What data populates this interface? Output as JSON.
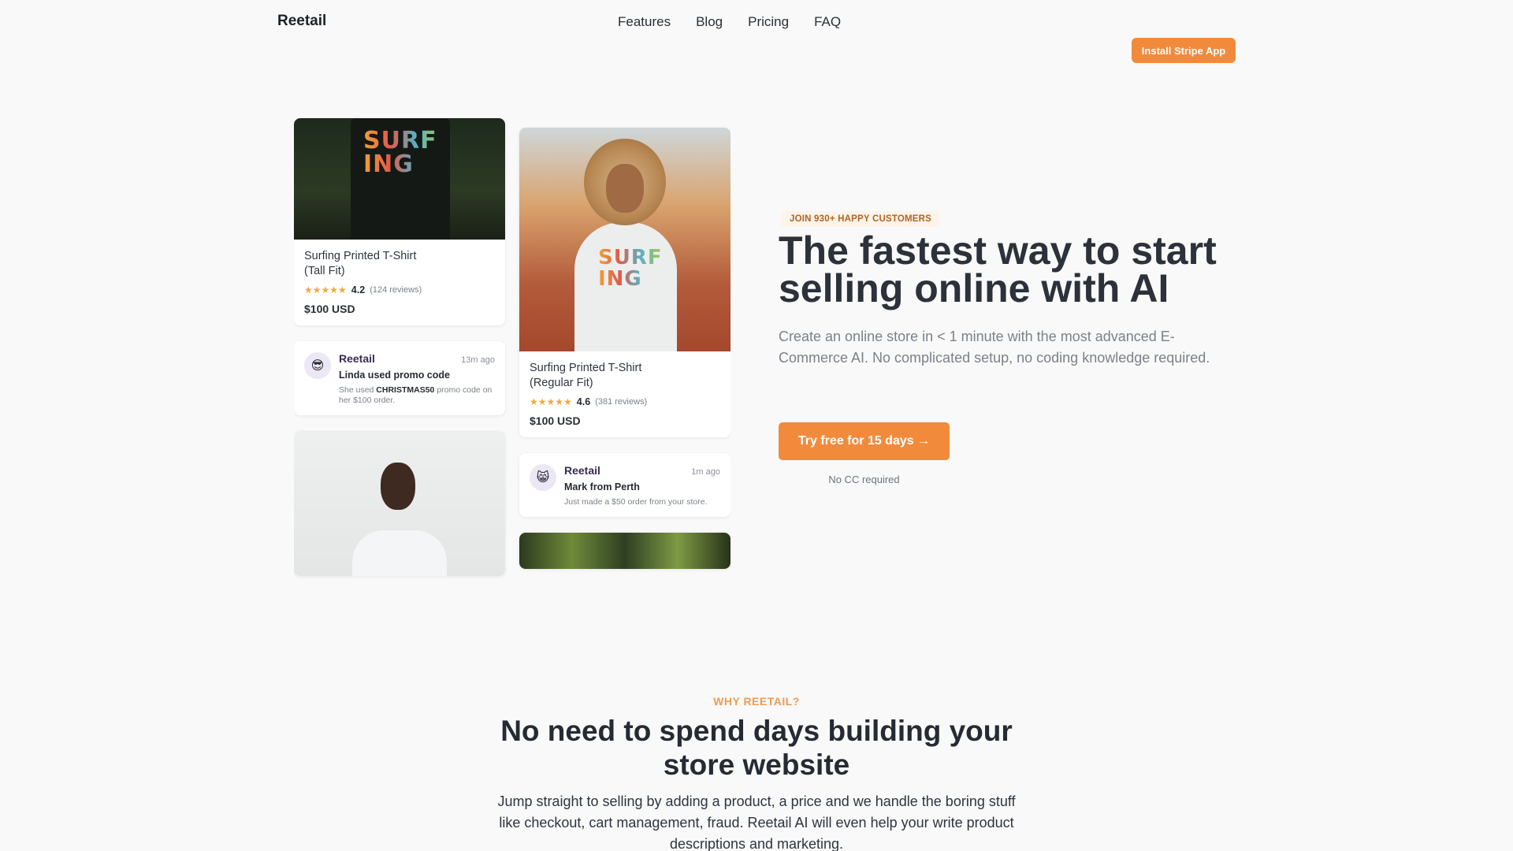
{
  "header": {
    "brand": "Reetail",
    "nav": [
      "Features",
      "Blog",
      "Pricing",
      "FAQ"
    ],
    "install_button": "Install Stripe App"
  },
  "mosaic": {
    "product1": {
      "title_line1": "Surfing Printed T-Shirt",
      "title_line2": "(Tall Fit)",
      "rating": "4.2",
      "reviews": "(124 reviews)",
      "price": "$100 USD",
      "shirt_print": "SURF ING"
    },
    "notif1": {
      "avatar_emoji": "😎",
      "brand": "Reetail",
      "time": "13m ago",
      "title": "Linda used promo code",
      "text_before": "She used",
      "code": "CHRISTMAS50",
      "text_after": "promo code on her $100 order."
    },
    "product2": {
      "title_line1": "Surfing Printed T-Shirt",
      "title_line2": "(Regular Fit)",
      "rating": "4.6",
      "reviews": "(381 reviews)",
      "price": "$100 USD",
      "shirt_print": "SURF ING"
    },
    "notif2": {
      "avatar_emoji": "😸",
      "brand": "Reetail",
      "time": "1m ago",
      "title": "Mark from Perth",
      "text": "Just made a $50 order from your store."
    },
    "stars": "★★★★★"
  },
  "hero": {
    "badge": "JOIN 930+ HAPPY CUSTOMERS",
    "title": "The fastest way to start selling online with AI",
    "subtitle": "Create an online store in < 1 minute with the most advanced E-Commerce AI. No complicated setup, no coding knowledge required.",
    "cta": "Try free for 15 days →",
    "cta_note": "No CC required"
  },
  "why": {
    "eyebrow": "WHY REETAIL?",
    "title": "No need to spend days building your store website",
    "text": "Jump straight to selling by adding a product, a price and we handle the boring stuff like checkout, cart management, fraud. Reetail AI will even help your write product descriptions and marketing."
  },
  "colors": {
    "accent": "#f28a3c",
    "background": "#f8f9f8",
    "text": "#262a33"
  }
}
